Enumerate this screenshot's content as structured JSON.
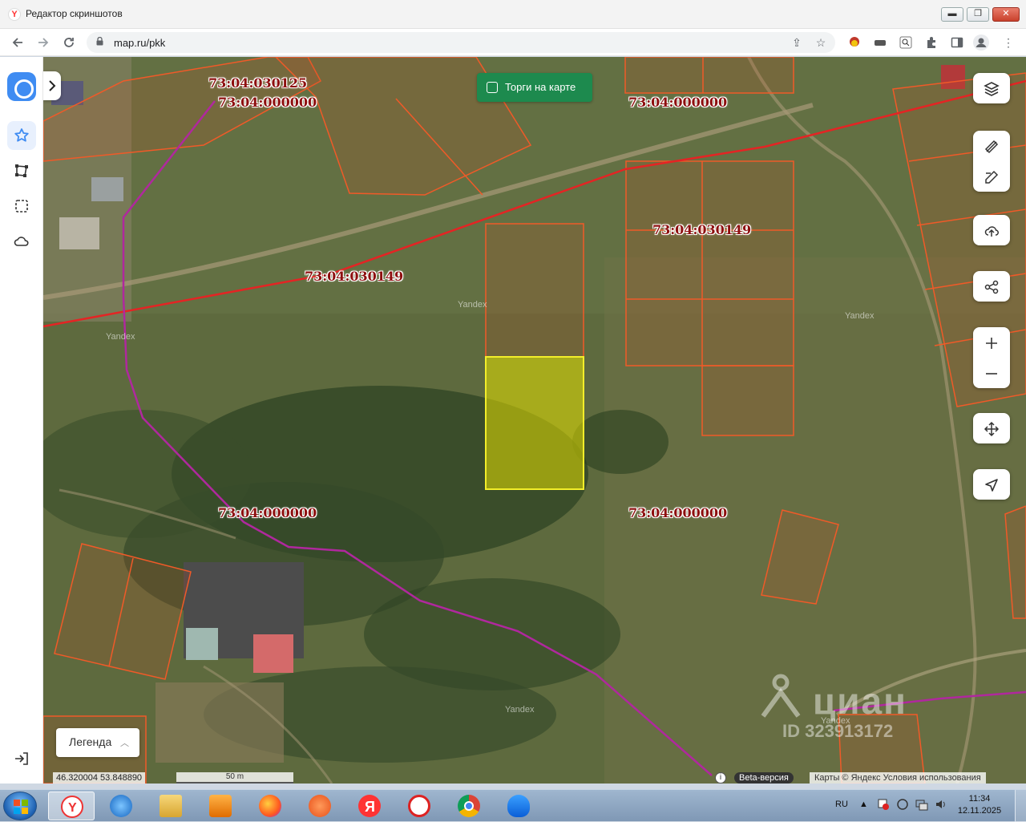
{
  "window": {
    "title": "Редактор скриншотов",
    "minimize": "▬",
    "maximize": "❐",
    "close": "✕"
  },
  "browser": {
    "url": "map.ru/pkk",
    "back_icon": "arrow-left-icon",
    "forward_icon": "arrow-right-icon",
    "reload_icon": "reload-icon"
  },
  "sidebar": {
    "items": [
      {
        "icon": "star-icon",
        "active": true
      },
      {
        "icon": "polygon-icon"
      },
      {
        "icon": "selection-icon"
      },
      {
        "icon": "cloud-icon"
      }
    ],
    "bottom_icon": "logout-icon"
  },
  "map": {
    "auction_label": "Торги на карте",
    "legend_label": "Легенда",
    "coordinates": "46.320004 53.848890",
    "scale": "50 m",
    "beta": "Beta-версия",
    "copyright": "Карты © Яндекс Условия использования",
    "cadastral_labels": [
      "73:04:030125",
      "73:04:000000",
      "73:04:000000",
      "73:04:030149",
      "73:04:030149",
      "73:04:000000",
      "73:04:000000"
    ],
    "watermark": "Yandex",
    "cian_name": "циан",
    "cian_id": "ID 323913172",
    "controls": [
      "layers-icon",
      "ruler-icon",
      "edit-icon",
      "upload-cloud-icon",
      "share-icon",
      "zoom-in-icon",
      "zoom-out-icon",
      "move-icon",
      "locate-icon"
    ],
    "colors": {
      "parcel_border": "#f05a28",
      "selected_parcel": "#e8e400",
      "road_line": "#e42424",
      "district_line": "#b0289e",
      "auction_button": "#1d8a4e"
    }
  },
  "taskbar": {
    "lang": "RU",
    "time": "11:34",
    "date": "12.11.2025",
    "apps": [
      "yandex-browser-icon",
      "internet-explorer-icon",
      "file-explorer-icon",
      "media-player-icon",
      "firefox-icon",
      "app-icon",
      "yandex-icon",
      "ccleaner-icon",
      "chrome-icon",
      "cloud-app-icon"
    ]
  }
}
